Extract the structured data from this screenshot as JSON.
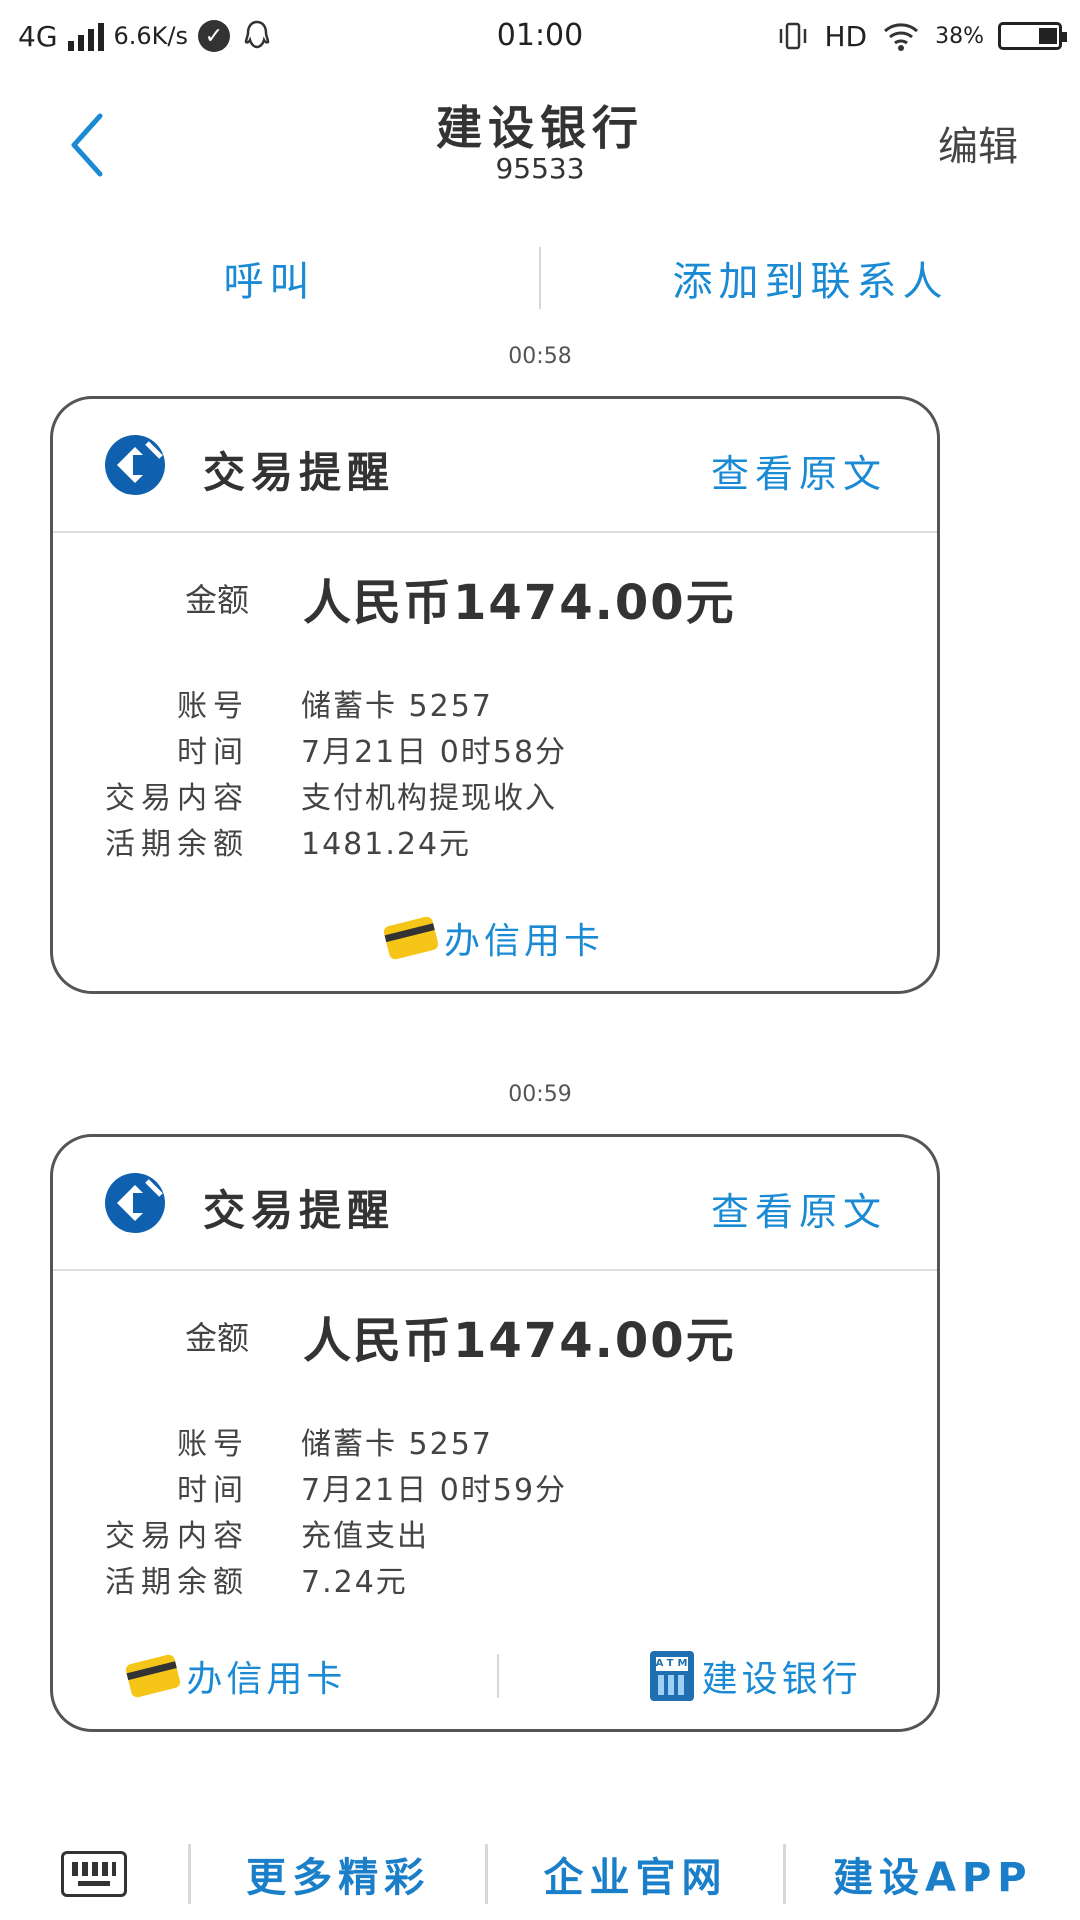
{
  "status_bar": {
    "network": "4G",
    "speed": "6.6K/s",
    "time": "01:00",
    "hd": "HD",
    "battery": "38%"
  },
  "header": {
    "title": "建设银行",
    "number": "95533",
    "edit_label": "编辑"
  },
  "actions": {
    "call_label": "呼叫",
    "add_contact_label": "添加到联系人"
  },
  "messages": [
    {
      "timestamp": "00:58",
      "card_title": "交易提醒",
      "view_original": "查看原文",
      "amount_label": "金额",
      "amount_value": "人民币1474.00元",
      "fields": [
        {
          "label": "账号",
          "value": "储蓄卡 5257"
        },
        {
          "label": "时间",
          "value": "7月21日 0时58分"
        },
        {
          "label": "交易内容",
          "value": "支付机构提现收入"
        },
        {
          "label": "活期余额",
          "value": "1481.24元"
        }
      ],
      "links": [
        "办信用卡"
      ]
    },
    {
      "timestamp": "00:59",
      "card_title": "交易提醒",
      "view_original": "查看原文",
      "amount_label": "金额",
      "amount_value": "人民币1474.00元",
      "fields": [
        {
          "label": "账号",
          "value": "储蓄卡 5257"
        },
        {
          "label": "时间",
          "value": "7月21日 0时59分"
        },
        {
          "label": "交易内容",
          "value": "充值支出"
        },
        {
          "label": "活期余额",
          "value": "7.24元"
        }
      ],
      "links": [
        "办信用卡",
        "建设银行"
      ]
    }
  ],
  "bottom_menu": [
    "更多精彩",
    "企业官网",
    "建设APP"
  ],
  "colors": {
    "accent": "#1a8ad4",
    "bank_logo": "#1060b0"
  }
}
